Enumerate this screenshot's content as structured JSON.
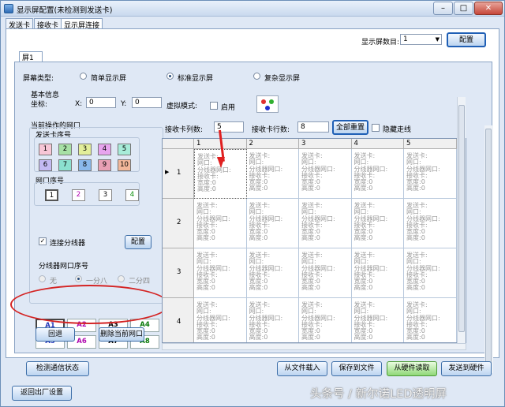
{
  "window": {
    "title": "显示屏配置(未检测到发送卡)",
    "min": "–",
    "max": "□",
    "close": "✕"
  },
  "main_tabs": [
    "发送卡",
    "接收卡",
    "显示屏连接"
  ],
  "screen_count": {
    "label": "显示屏数目:",
    "value": "1",
    "config_button": "配置"
  },
  "sub_tab": "屏1",
  "screen_type": {
    "label": "屏幕类型:",
    "options": [
      "简单显示屏",
      "标准显示屏",
      "复杂显示屏"
    ],
    "selected": "标准显示屏"
  },
  "basic_info": {
    "label": "基本信息",
    "coords_label": "坐标:",
    "x_label": "X:",
    "x_value": "0",
    "y_label": "Y:",
    "y_value": "0",
    "virtual_mode_label": "虚拟模式:",
    "enable_label": "启用"
  },
  "net_port": {
    "label": "当前操作的网口",
    "sender_seq_label": "发送卡序号",
    "sender_cards": [
      "1",
      "2",
      "3",
      "4",
      "5",
      "6",
      "7",
      "8",
      "9",
      "10"
    ],
    "sender_colors": [
      "#f7c6d6",
      "#a7e0a5",
      "#e3ee9a",
      "#e7a4ee",
      "#a7ecd9",
      "#c2b9f2",
      "#8be0cf",
      "#8ab8ec",
      "#e8a0b4",
      "#f2b79a"
    ],
    "port_seq_label": "网口序号",
    "ports": [
      "1",
      "2",
      "3",
      "4"
    ],
    "port_colors": [
      "#000000",
      "#b000b0",
      "#000000",
      "#008a00"
    ]
  },
  "splitter": {
    "connect_label": "连接分线器",
    "config_button": "配置",
    "port_seq_label": "分线器网口序号",
    "modes": [
      "无",
      "一分八",
      "二分四"
    ],
    "selected_mode": "一分八",
    "ports_row1": [
      "A1",
      "A2",
      "A3",
      "A4"
    ],
    "ports_row2": [
      "A5",
      "A6",
      "A7",
      "A8"
    ],
    "port_colors": [
      "#2438b8",
      "#b00cb0",
      "#000000",
      "#0a7a0a",
      "#2438b8",
      "#b00cb0",
      "#000000",
      "#0a7a0a"
    ]
  },
  "undo_button": "回退",
  "delete_port_button": "删除当前网口",
  "grid_controls": {
    "cols_label": "接收卡列数:",
    "cols_value": "5",
    "rows_label": "接收卡行数:",
    "rows_value": "8",
    "reset_all_button": "全部重置",
    "hide_trace_label": "隐藏走线"
  },
  "grid": {
    "col_headers": [
      "1",
      "2",
      "3",
      "4",
      "5"
    ],
    "row_headers": [
      "1",
      "2",
      "3",
      "4"
    ],
    "cell_lines": [
      "发送卡:",
      "网口:",
      "分线器网口:",
      "接收卡:",
      "宽度:0",
      "高度:0"
    ]
  },
  "bottom": {
    "detect_button": "检测通信状态",
    "load_file_button": "从文件载入",
    "save_file_button": "保存到文件",
    "read_hw_button": "从硬件读取",
    "send_hw_button": "发送到硬件",
    "factory_button": "返回出厂设置"
  },
  "watermark": "头条号 / 新尔诺LED透明屏"
}
